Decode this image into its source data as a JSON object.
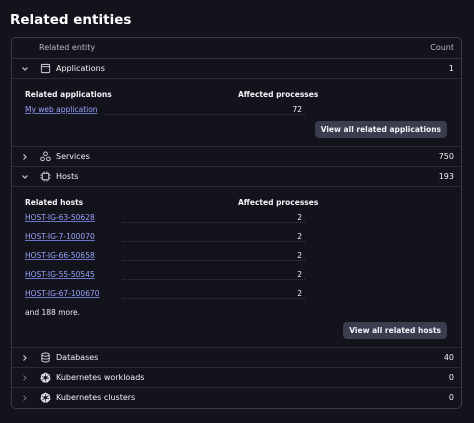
{
  "page_title": "Related entities",
  "header": {
    "entity_col": "Related entity",
    "count_col": "Count"
  },
  "applications": {
    "label": "Applications",
    "count": "1",
    "table_header": "Related applications",
    "processes_header": "Affected processes",
    "items": [
      {
        "name": "My web application",
        "value": "72"
      }
    ],
    "button": "View all related applications"
  },
  "services": {
    "label": "Services",
    "count": "750"
  },
  "hosts": {
    "label": "Hosts",
    "count": "193",
    "table_header": "Related hosts",
    "processes_header": "Affected processes",
    "items": [
      {
        "name": "HOST-IG-63-50628",
        "value": "2"
      },
      {
        "name": "HOST-IG-7-100070",
        "value": "2"
      },
      {
        "name": "HOST-IG-66-50658",
        "value": "2"
      },
      {
        "name": "HOST-IG-55-50545",
        "value": "2"
      },
      {
        "name": "HOST-IG-67-100670",
        "value": "2"
      }
    ],
    "more_text": "and 188 more.",
    "button": "View all related hosts"
  },
  "databases": {
    "label": "Databases",
    "count": "40"
  },
  "k8s_workloads": {
    "label": "Kubernetes workloads",
    "count": "0"
  },
  "k8s_clusters": {
    "label": "Kubernetes clusters",
    "count": "0"
  },
  "icons": {
    "applications": "application-window-icon",
    "services": "services-icon",
    "hosts": "host-icon",
    "databases": "database-icon",
    "kubernetes": "kubernetes-icon"
  }
}
